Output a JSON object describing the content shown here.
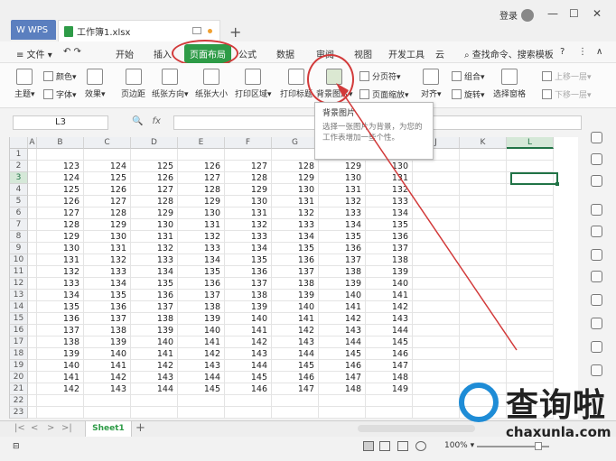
{
  "app": {
    "brand_tab": "WPS",
    "doc_tab": "工作簿1.xlsx",
    "login_label": "登录",
    "window_controls": [
      "—",
      "☐",
      "✕"
    ]
  },
  "menu": {
    "file_label": "≡ 文件 ▾",
    "items": [
      "开始",
      "插入",
      "页面布局",
      "公式",
      "数据",
      "审阅",
      "视图",
      "开发工具",
      "云"
    ],
    "active": "页面布局",
    "search_label": "查找命令、搜索模板",
    "help_icon": "question-icon"
  },
  "ribbon": {
    "theme": "主题▾",
    "color": "颜色▾",
    "font": "字体▾",
    "effect": "效果▾",
    "margins": "页边距",
    "orientation": "纸张方向▾",
    "size": "纸张大小",
    "print_area": "打印区域▾",
    "print_titles": "打印标题",
    "background": "背景图片▾",
    "breaks": "分页符▾",
    "scale": "页面缩放▾",
    "align": "对齐▾",
    "group": "组合▾",
    "rotate": "旋转▾",
    "selection_pane": "选择窗格",
    "up_one": "上移一层▾",
    "down_one": "下移一层▾"
  },
  "formula_bar": {
    "name_box": "L3",
    "fx": "fx",
    "value": ""
  },
  "tooltip": {
    "title": "背景图片",
    "body": "选择一张图片为背景，为您的工作表增加一些个性。"
  },
  "grid": {
    "columns": [
      "A",
      "B",
      "C",
      "D",
      "E",
      "F",
      "G",
      "H",
      "I",
      "J",
      "K",
      "L"
    ],
    "selected_column": "L",
    "rows": [
      "1",
      "2",
      "3",
      "4",
      "5",
      "6",
      "7",
      "8",
      "9",
      "10",
      "11",
      "12",
      "13",
      "14",
      "15",
      "16",
      "17",
      "18",
      "19",
      "20",
      "21",
      "22",
      "23"
    ],
    "selected_row": "3",
    "data": [
      [
        123,
        124,
        125,
        126,
        127,
        128,
        129,
        130
      ],
      [
        124,
        125,
        126,
        127,
        128,
        129,
        130,
        131
      ],
      [
        125,
        126,
        127,
        128,
        129,
        130,
        131,
        132
      ],
      [
        126,
        127,
        128,
        129,
        130,
        131,
        132,
        133
      ],
      [
        127,
        128,
        129,
        130,
        131,
        132,
        133,
        134
      ],
      [
        128,
        129,
        130,
        131,
        132,
        133,
        134,
        135
      ],
      [
        129,
        130,
        131,
        132,
        133,
        134,
        135,
        136
      ],
      [
        130,
        131,
        132,
        133,
        134,
        135,
        136,
        137
      ],
      [
        131,
        132,
        133,
        134,
        135,
        136,
        137,
        138
      ],
      [
        132,
        133,
        134,
        135,
        136,
        137,
        138,
        139
      ],
      [
        133,
        134,
        135,
        136,
        137,
        138,
        139,
        140
      ],
      [
        134,
        135,
        136,
        137,
        138,
        139,
        140,
        141
      ],
      [
        135,
        136,
        137,
        138,
        139,
        140,
        141,
        142
      ],
      [
        136,
        137,
        138,
        139,
        140,
        141,
        142,
        143
      ],
      [
        137,
        138,
        139,
        140,
        141,
        142,
        143,
        144
      ],
      [
        138,
        139,
        140,
        141,
        142,
        143,
        144,
        145
      ],
      [
        139,
        140,
        141,
        142,
        143,
        144,
        145,
        146
      ],
      [
        140,
        141,
        142,
        143,
        144,
        145,
        146,
        147
      ],
      [
        141,
        142,
        143,
        144,
        145,
        146,
        147,
        148
      ],
      [
        142,
        143,
        144,
        145,
        146,
        147,
        148,
        149
      ]
    ]
  },
  "sheets": {
    "tabs": [
      "Sheet1"
    ],
    "add": "+"
  },
  "status": {
    "zoom": "100% ▾"
  },
  "watermark": {
    "cn": "查询啦",
    "url": "chaxunla.com"
  },
  "annotation_color": "#d23a3a",
  "accent_color": "#2e9b47"
}
